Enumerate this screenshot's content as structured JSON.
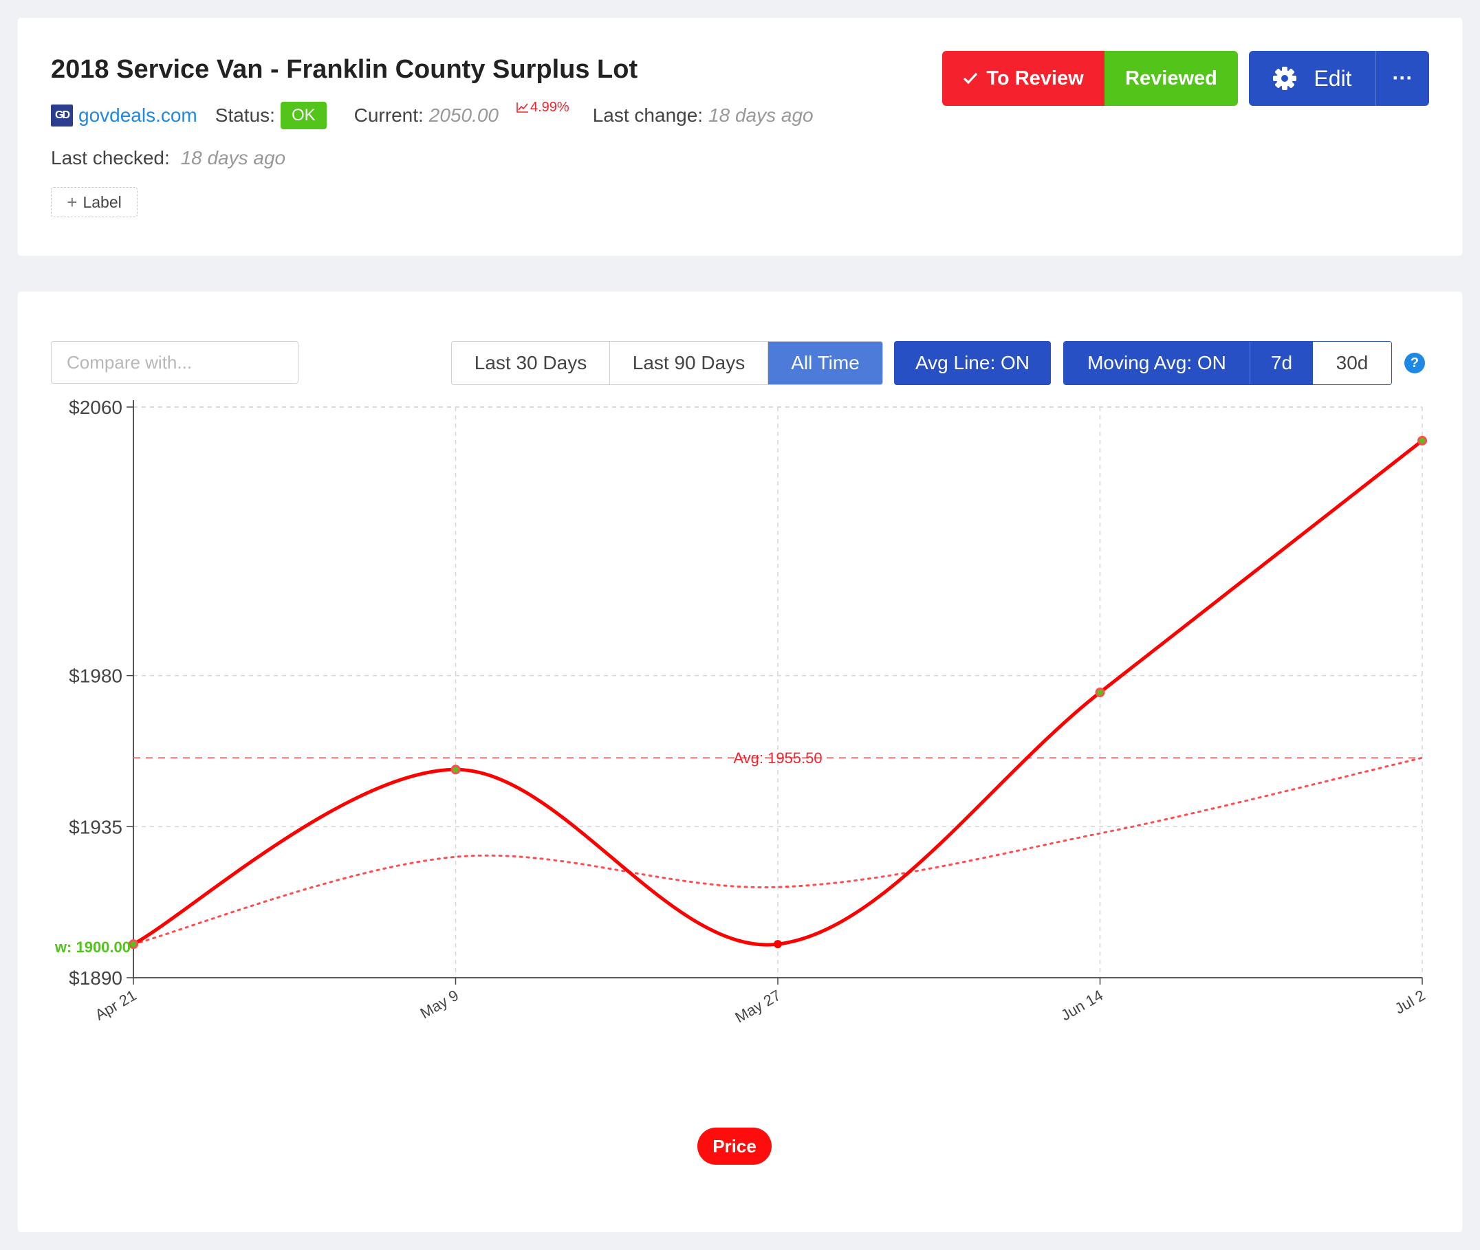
{
  "header": {
    "title": "2018 Service Van - Franklin County Surplus Lot",
    "site_logo_text": "GD",
    "site": "govdeals.com",
    "status_label": "Status:",
    "status": "OK",
    "current_label": "Current:",
    "current_value": "2050.00",
    "change_percent": "4.99%",
    "last_change_label": "Last change:",
    "last_change_value": "18 days ago",
    "last_checked_label": "Last checked:",
    "last_checked_value": "18 days ago",
    "label_button": "Label"
  },
  "actions": {
    "to_review": "To Review",
    "reviewed": "Reviewed",
    "edit": "Edit",
    "more": "···"
  },
  "controls": {
    "compare_placeholder": "Compare with...",
    "ranges": [
      "Last 30 Days",
      "Last 90 Days",
      "All Time"
    ],
    "active_range": "All Time",
    "avg_line": "Avg Line: ON",
    "moving_avg": "Moving Avg: ON",
    "ma_windows": [
      "7d",
      "30d"
    ],
    "active_ma_window": "7d",
    "help": "?"
  },
  "colors": {
    "price_line": "#ff0000",
    "moving_avg_line": "#ff4d4f",
    "status_ok": "#52c41a",
    "primary": "#2650c4",
    "danger": "#f5222d"
  },
  "chart_data": {
    "type": "line",
    "x": [
      "Apr 21",
      "May 9",
      "May 27",
      "Jun 14",
      "Jul 2"
    ],
    "series": [
      {
        "name": "Price",
        "values": [
          1900,
          1952,
          1900,
          1975,
          2050
        ]
      },
      {
        "values": [
          1900,
          1926,
          1917,
          1933,
          1955.5
        ],
        "style": "dotted"
      }
    ],
    "y_ticks": [
      "$1890",
      "$1935",
      "$1980",
      "$2060"
    ],
    "ylim": [
      1890,
      2060
    ],
    "avg_line": {
      "value": 1955.5,
      "label": "Avg: 1955.50"
    },
    "low_marker": {
      "value": 1900,
      "label": "w: 1900.00"
    },
    "legend": "Price",
    "legend_position": "bottom-center",
    "grid": true
  }
}
